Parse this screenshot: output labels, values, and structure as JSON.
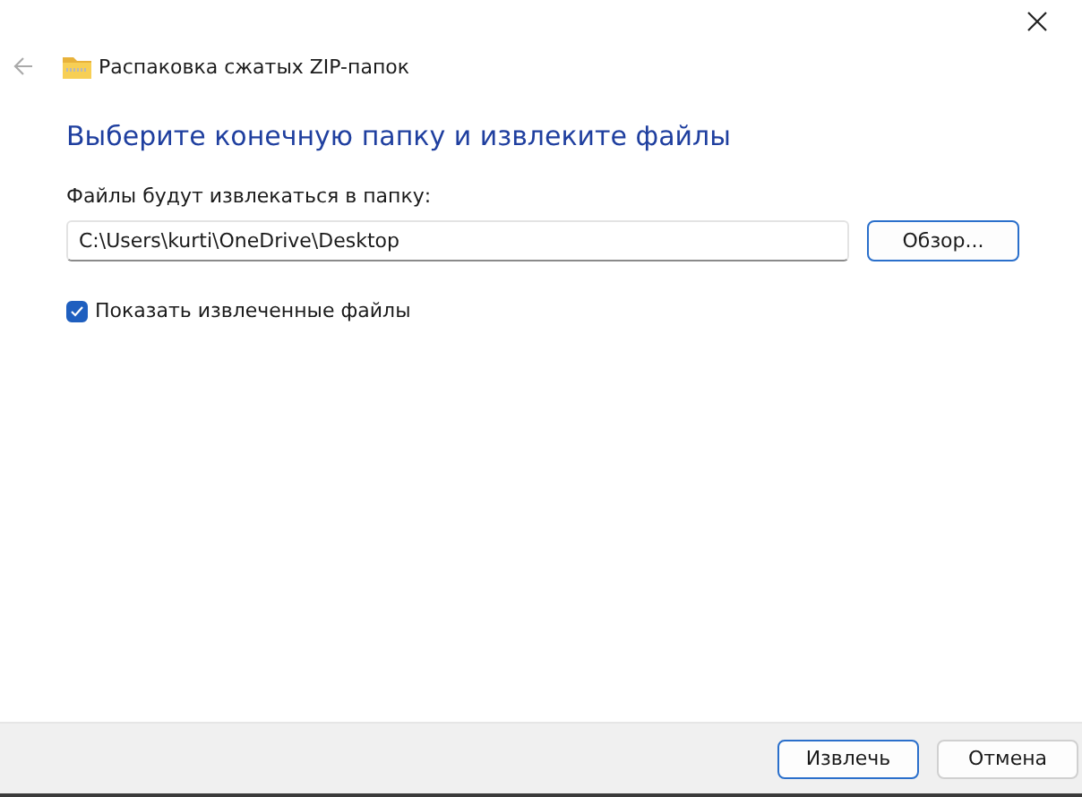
{
  "window": {
    "title": "Распаковка сжатых ZIP-папок"
  },
  "heading": "Выберите конечную папку и извлеките файлы",
  "destination": {
    "label": "Файлы будут извлекаться в папку:",
    "value": "C:\\Users\\kurti\\OneDrive\\Desktop",
    "browse_button": "Обзор..."
  },
  "show_files": {
    "label": "Показать извлеченные файлы",
    "checked": true
  },
  "buttons": [
    {
      "label": "Извлечь",
      "selected": true
    },
    {
      "label": "Отмена",
      "selected": false
    }
  ]
}
